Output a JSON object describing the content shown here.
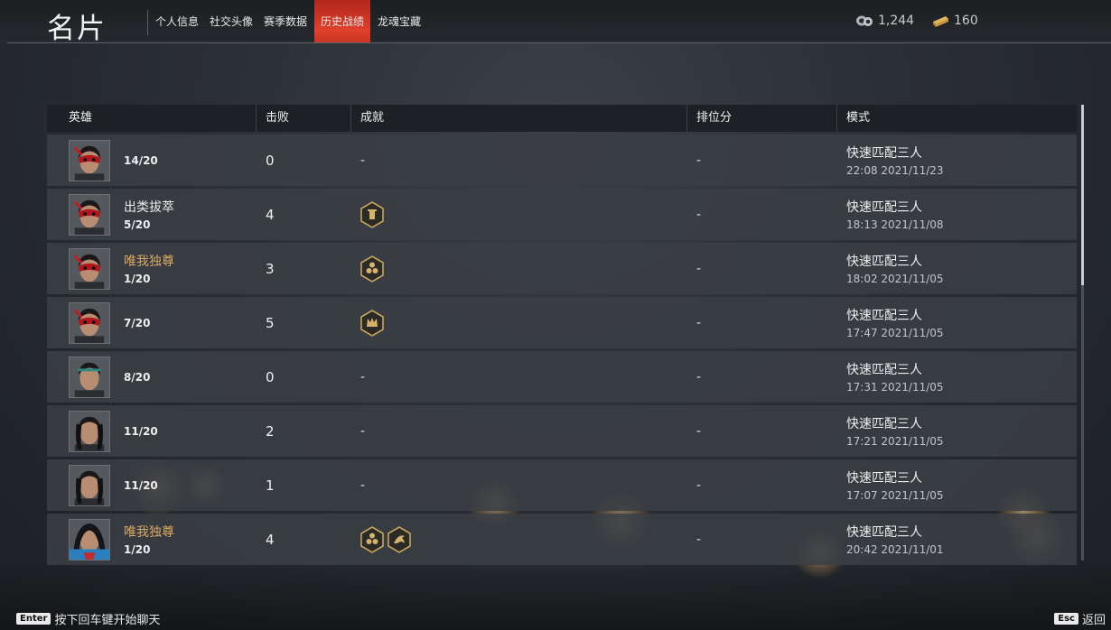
{
  "header": {
    "title": "名片",
    "tabs": [
      {
        "label": "个人信息",
        "active": false
      },
      {
        "label": "社交头像",
        "active": false
      },
      {
        "label": "赛季数据",
        "active": false
      },
      {
        "label": "历史战绩",
        "active": true
      },
      {
        "label": "龙魂宝藏",
        "active": false
      }
    ],
    "currencies": [
      {
        "icon": "coins-icon",
        "value": "1,244"
      },
      {
        "icon": "gold-ingot-icon",
        "value": "160"
      }
    ]
  },
  "table": {
    "columns": [
      "英雄",
      "击败",
      "成就",
      "排位分",
      "模式"
    ],
    "rows": [
      {
        "hero_avatar": "red-mask-hero-avatar",
        "title": "",
        "title_gold": false,
        "place": "14/20",
        "kills": "0",
        "achievements": [],
        "achievement_text": "-",
        "rank_score": "-",
        "mode": "快速匹配三人",
        "time": "22:08  2021/11/23"
      },
      {
        "hero_avatar": "red-mask-hero-avatar",
        "title": "出类拔萃",
        "title_gold": false,
        "place": "5/20",
        "kills": "4",
        "achievements": [
          "kill-count-badge-icon"
        ],
        "achievement_text": "",
        "rank_score": "-",
        "mode": "快速匹配三人",
        "time": "18:13  2021/11/08"
      },
      {
        "hero_avatar": "red-mask-hero-avatar",
        "title": "唯我独尊",
        "title_gold": true,
        "place": "1/20",
        "kills": "3",
        "achievements": [
          "triple-badge-icon"
        ],
        "achievement_text": "",
        "rank_score": "-",
        "mode": "快速匹配三人",
        "time": "18:02  2021/11/05"
      },
      {
        "hero_avatar": "red-mask-hero-avatar",
        "title": "",
        "title_gold": false,
        "place": "7/20",
        "kills": "5",
        "achievements": [
          "crown-badge-icon"
        ],
        "achievement_text": "",
        "rank_score": "-",
        "mode": "快速匹配三人",
        "time": "17:47  2021/11/05"
      },
      {
        "hero_avatar": "headband-hero-avatar",
        "title": "",
        "title_gold": false,
        "place": "8/20",
        "kills": "0",
        "achievements": [],
        "achievement_text": "-",
        "rank_score": "-",
        "mode": "快速匹配三人",
        "time": "17:31  2021/11/05"
      },
      {
        "hero_avatar": "long-hair-hero-avatar",
        "title": "",
        "title_gold": false,
        "place": "11/20",
        "kills": "2",
        "achievements": [],
        "achievement_text": "-",
        "rank_score": "-",
        "mode": "快速匹配三人",
        "time": "17:21  2021/11/05"
      },
      {
        "hero_avatar": "long-hair-hero-avatar",
        "title": "",
        "title_gold": false,
        "place": "11/20",
        "kills": "1",
        "achievements": [],
        "achievement_text": "-",
        "rank_score": "-",
        "mode": "快速匹配三人",
        "time": "17:07  2021/11/05"
      },
      {
        "hero_avatar": "hooded-hero-avatar",
        "title": "唯我独尊",
        "title_gold": true,
        "place": "1/20",
        "kills": "4",
        "achievements": [
          "triple-badge-icon",
          "jump-badge-icon"
        ],
        "achievement_text": "",
        "rank_score": "-",
        "mode": "快速匹配三人",
        "time": "20:42  2021/11/01"
      }
    ]
  },
  "footer": {
    "enter_key": "Enter",
    "enter_hint": "按下回车键开始聊天",
    "esc_key": "Esc",
    "esc_hint": "返回"
  },
  "colors": {
    "accent_tab": "#e0402c",
    "gold_text": "#d8a763",
    "row_bg": "#3a3f44",
    "header_bg": "#1d2125"
  }
}
